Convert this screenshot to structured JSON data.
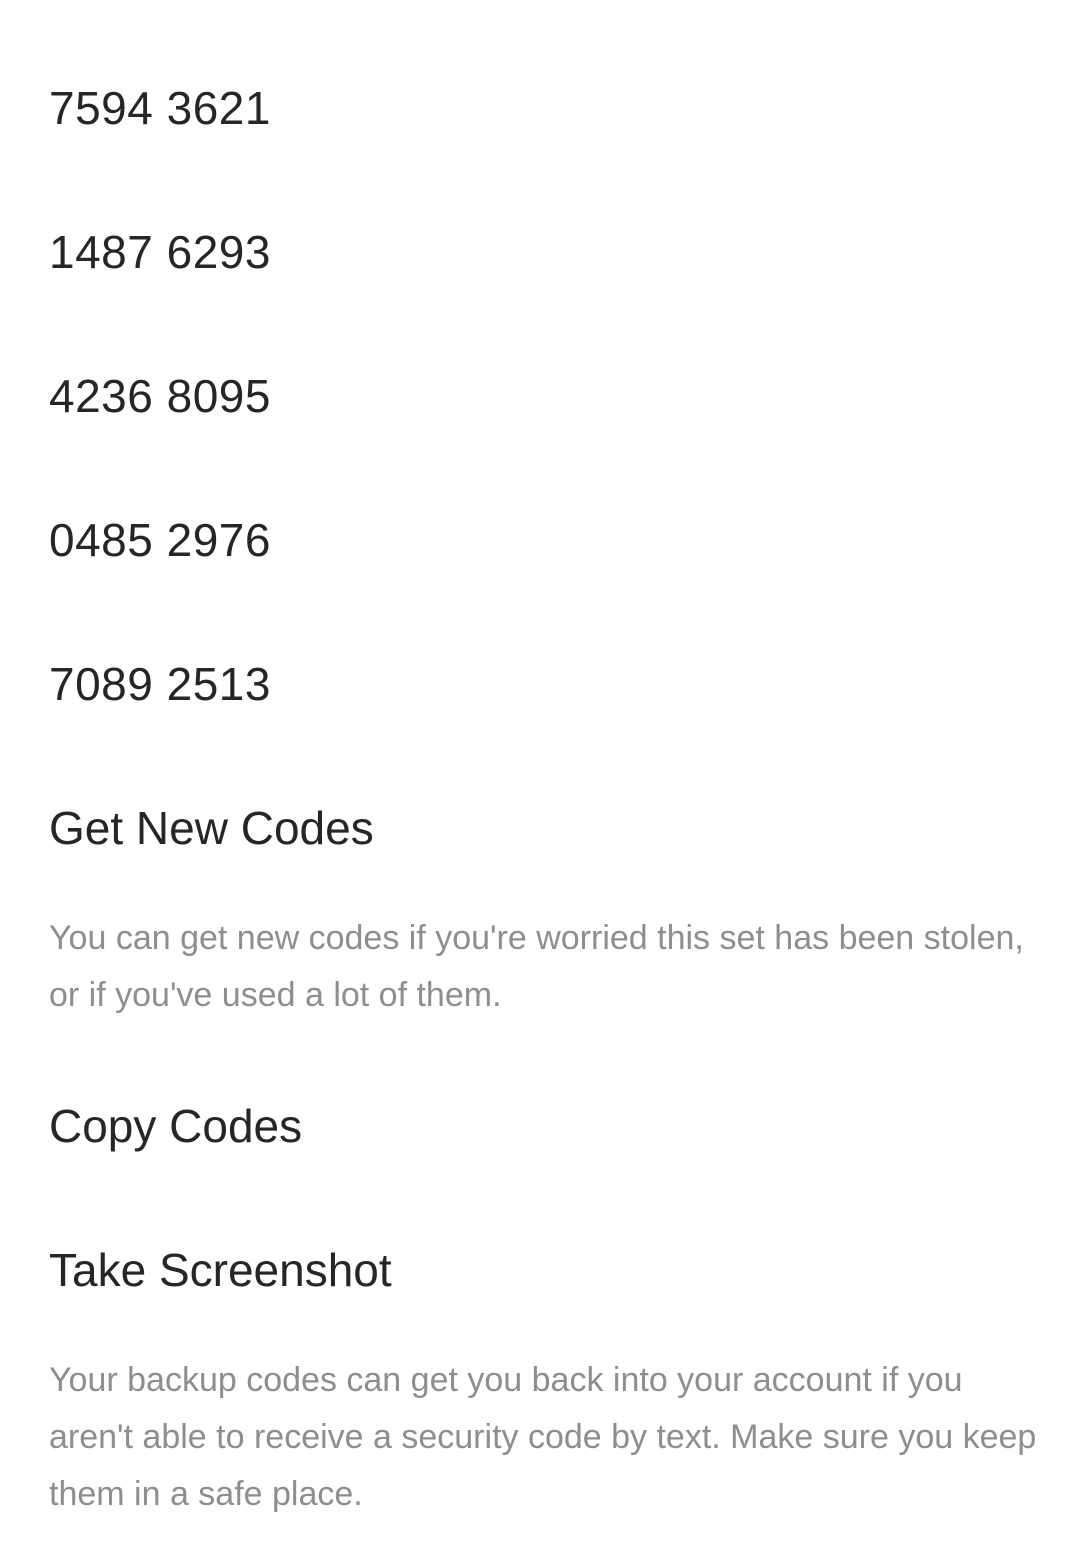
{
  "backup_codes": [
    "7594 3621",
    "1487 6293",
    "4236 8095",
    "0485 2976",
    "7089 2513"
  ],
  "actions": {
    "get_new_codes": {
      "label": "Get New Codes",
      "description": "You can get new codes if you're worried this set has been stolen, or if you've used a lot of them."
    },
    "copy_codes": {
      "label": "Copy Codes"
    },
    "take_screenshot": {
      "label": "Take Screenshot"
    }
  },
  "footer": {
    "description": "Your backup codes can get you back into your account if you aren't able to receive a security code by text. Make sure you keep them in a safe place."
  },
  "colors": {
    "primary_text": "#262626",
    "secondary_text": "#8e8e8e",
    "background": "#ffffff"
  }
}
